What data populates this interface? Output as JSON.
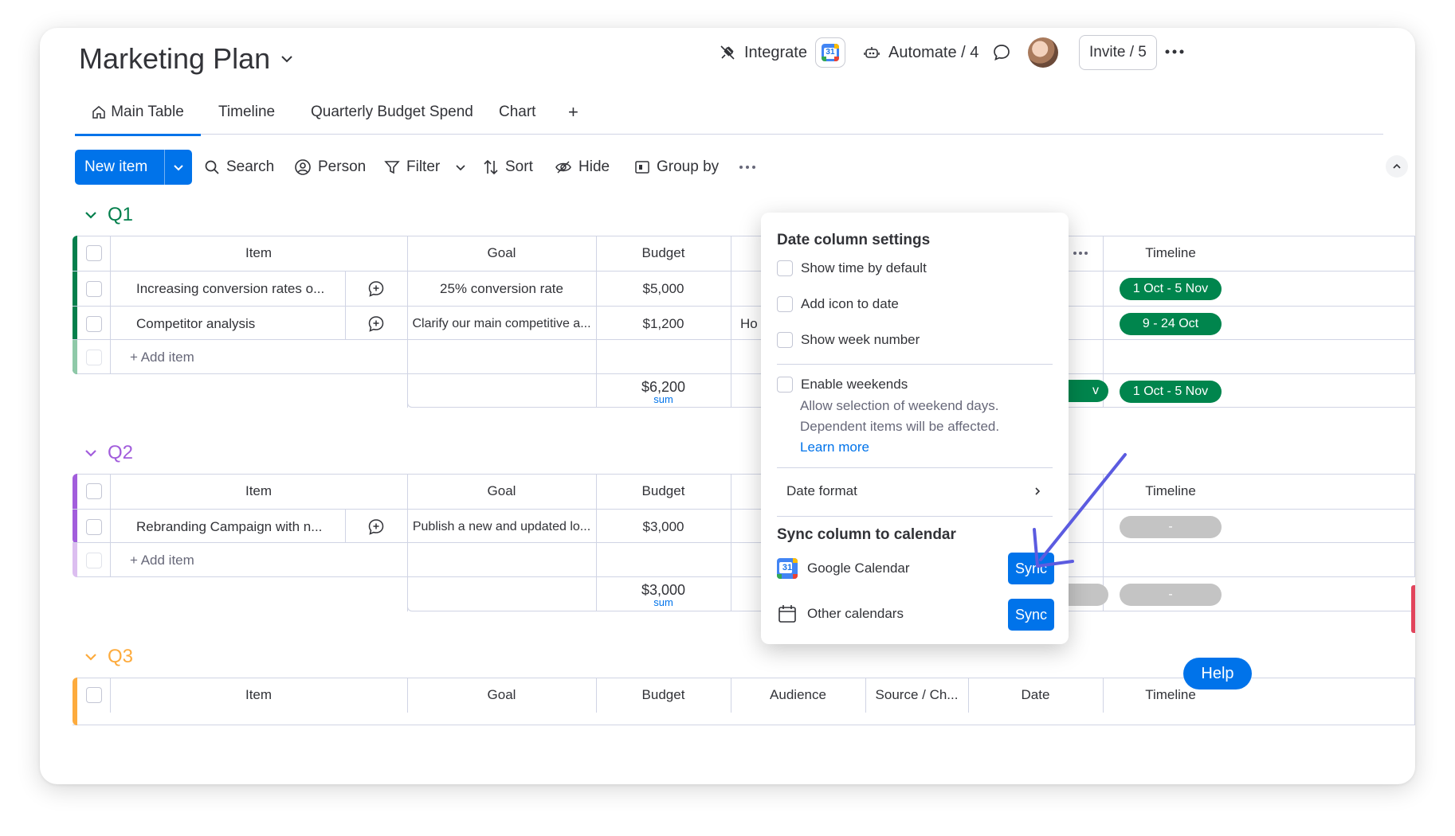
{
  "board": {
    "title": "Marketing Plan"
  },
  "header": {
    "integrate_label": "Integrate",
    "automate_label": "Automate / 4",
    "invite_label": "Invite / 5"
  },
  "tabs": [
    {
      "label": "Main Table",
      "active": true
    },
    {
      "label": "Timeline"
    },
    {
      "label": "Quarterly Budget Spend"
    },
    {
      "label": "Chart"
    },
    {
      "label": "+"
    }
  ],
  "toolbar": {
    "new_item": "New item",
    "search": "Search",
    "person": "Person",
    "filter": "Filter",
    "sort": "Sort",
    "hide": "Hide",
    "group_by": "Group by"
  },
  "columns": {
    "item": "Item",
    "goal": "Goal",
    "budget": "Budget",
    "audience": "Audience",
    "source": "Source / Ch...",
    "date": "Date",
    "timeline": "Timeline"
  },
  "groups": [
    {
      "name": "Q1",
      "color": "#037f4c",
      "rows": [
        {
          "item": "Increasing conversion rates o...",
          "goal": "25% conversion rate",
          "budget": "$5,000",
          "audience": "",
          "timeline": "1 Oct - 5 Nov"
        },
        {
          "item": "Competitor analysis",
          "goal": "Clarify our main competitive a...",
          "budget": "$1,200",
          "audience": "Ho",
          "timeline": "9 - 24 Oct"
        }
      ],
      "add_item": "+ Add item",
      "sum_value": "$6,200",
      "sum_label": "sum",
      "sum_date": "v",
      "sum_timeline": "1 Oct - 5 Nov"
    },
    {
      "name": "Q2",
      "color": "#a25ddc",
      "rows": [
        {
          "item": "Rebranding Campaign with n...",
          "goal": "Publish a new and updated lo...",
          "budget": "$3,000",
          "timeline": "-"
        }
      ],
      "add_item": "+ Add item",
      "sum_value": "$3,000",
      "sum_label": "sum",
      "sum_timeline": "-"
    },
    {
      "name": "Q3",
      "color": "#fdab3d"
    }
  ],
  "date_settings": {
    "title": "Date column settings",
    "show_time": "Show time by default",
    "add_icon": "Add icon to date",
    "show_week": "Show week number",
    "enable_weekends": "Enable weekends",
    "weekends_desc_1": "Allow selection of weekend days.",
    "weekends_desc_2": "Dependent items will be affected.",
    "learn_more": "Learn more",
    "date_format": "Date format",
    "sync_title": "Sync column to calendar",
    "google_calendar": "Google Calendar",
    "other_calendars": "Other calendars",
    "sync_label": "Sync"
  },
  "help": {
    "label": "Help"
  },
  "colors": {
    "primary": "#0073ea",
    "annotation_arrow": "#5b5be0"
  }
}
